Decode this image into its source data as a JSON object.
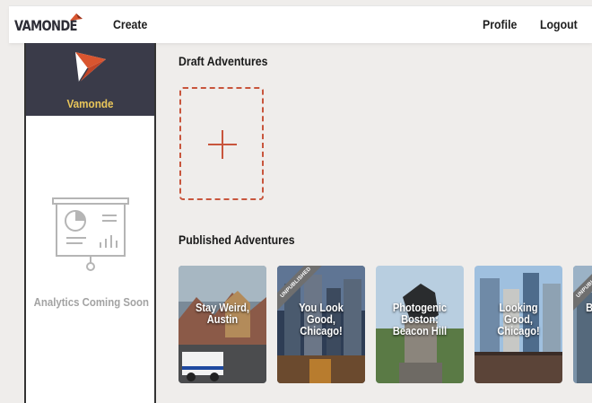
{
  "header": {
    "logo_text": "VAMONDE",
    "nav": {
      "create": "Create",
      "profile": "Profile",
      "logout": "Logout"
    }
  },
  "sidebar": {
    "brand_name": "Vamonde",
    "analytics_label": "Analytics Coming Soon"
  },
  "drafts": {
    "title": "Draft Adventures"
  },
  "published": {
    "title": "Published Adventures",
    "cards": [
      {
        "title": "Stay Weird, Austin",
        "ribbon": ""
      },
      {
        "title": "You Look Good, Chicago!",
        "ribbon": "UNPUBLISHED"
      },
      {
        "title": "Photogenic Boston: Beacon Hill",
        "ribbon": ""
      },
      {
        "title": "Looking Good, Chicago!",
        "ribbon": ""
      },
      {
        "title": "B",
        "ribbon": "UNPUBLISHED"
      }
    ]
  },
  "colors": {
    "accent": "#c8553c",
    "brand_bg": "#3a3b49",
    "brand_gold": "#e9c65a"
  }
}
